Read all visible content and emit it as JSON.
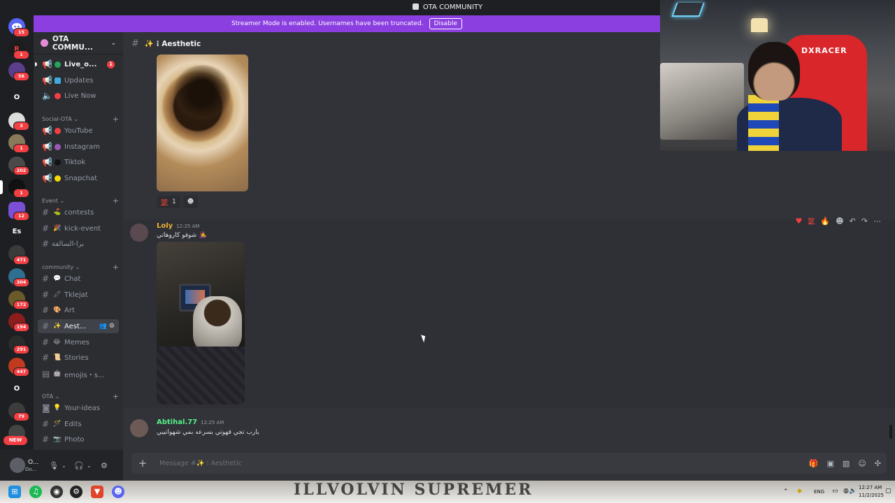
{
  "window": {
    "title": "OTA COMMUNITY"
  },
  "banner": {
    "text": "Streamer Mode is enabled. Usernames have been truncated.",
    "disable_label": "Disable"
  },
  "servers": [
    {
      "label": "",
      "badge": "15"
    },
    {
      "label": "R",
      "badge": "1"
    },
    {
      "label": "",
      "badge": "56"
    },
    {
      "label": "O",
      "badge": ""
    },
    {
      "label": "",
      "badge": "3"
    },
    {
      "label": "",
      "badge": "1"
    },
    {
      "label": "",
      "badge": "202"
    },
    {
      "label": "",
      "badge": "1"
    },
    {
      "label": "",
      "badge": "12"
    },
    {
      "label": "Es",
      "badge": ""
    },
    {
      "label": "",
      "badge": "471"
    },
    {
      "label": "",
      "badge": "304"
    },
    {
      "label": "",
      "badge": "172"
    },
    {
      "label": "",
      "badge": "194"
    },
    {
      "label": "",
      "badge": "291"
    },
    {
      "label": "",
      "badge": "447"
    },
    {
      "label": "O",
      "badge": ""
    },
    {
      "label": "",
      "badge": "79"
    },
    {
      "label": "",
      "badge": "NEW"
    }
  ],
  "sidebar": {
    "server_name": "OTA COMMU...",
    "channels_top": [
      {
        "name": "Live_o...",
        "dot": "#23a55a",
        "badge": "1"
      },
      {
        "name": "Updates",
        "dot": "#3fa9e0"
      },
      {
        "name": "Live Now",
        "dot": "#f23f43"
      }
    ],
    "categories": {
      "social": "Social-OTA",
      "event": "Event",
      "community": "community",
      "ota": "OTA"
    },
    "social_channels": [
      {
        "name": "YouTube",
        "dot": "#f23f43"
      },
      {
        "name": "Instagram",
        "dot": "#9b59b6"
      },
      {
        "name": "Tiktok",
        "dot": "#111214"
      },
      {
        "name": "Snapchat",
        "dot": "#f5d90a"
      }
    ],
    "event_channels": [
      {
        "name": "contests",
        "emoji": "⛳"
      },
      {
        "name": "kick-event",
        "emoji": "🎉"
      },
      {
        "name": "برا-السالفة",
        "emoji": ""
      }
    ],
    "community_channels": [
      {
        "name": "Chat",
        "emoji": "💬"
      },
      {
        "name": "Tklejat",
        "emoji": "🖍"
      },
      {
        "name": "Art",
        "emoji": "🎨"
      },
      {
        "name": "Aest...",
        "emoji": "✨"
      },
      {
        "name": "Memes",
        "emoji": "😂"
      },
      {
        "name": "Stories",
        "emoji": "📜"
      },
      {
        "name": "emojis・s...",
        "emoji": "🤖"
      }
    ],
    "ota_channels": [
      {
        "name": "Your-ideas",
        "emoji": "💡"
      },
      {
        "name": "Edits",
        "emoji": "🪄"
      },
      {
        "name": "Photo",
        "emoji": "📷"
      }
    ]
  },
  "user_panel": {
    "name": "O...",
    "status": "Do..."
  },
  "channel": {
    "name": "✨ ⁝ Aesthetic"
  },
  "reaction1": {
    "emoji": "💯",
    "count": "1"
  },
  "messages": [
    {
      "author": "Loly",
      "color": "#f0b232",
      "time": "12:25 AM",
      "text": "شوفو كاروهاتي",
      "emoji": "👩‍🎤"
    },
    {
      "author": "Abtihal.77",
      "color": "#57f287",
      "time": "12:25 AM",
      "text": "يارب تجي قهوتي بسرعه بمي شهواتييي"
    }
  ],
  "composer": {
    "placeholder": "Message #✨ ⁝ Aesthetic"
  },
  "webcam": {
    "chair_brand": "DXRACER"
  },
  "taskbar": {
    "shirt_text": "ILLVOLVIN  SUPREMER",
    "lang": "ENG",
    "time": "12:27 AM",
    "date": "11/2/2025"
  }
}
